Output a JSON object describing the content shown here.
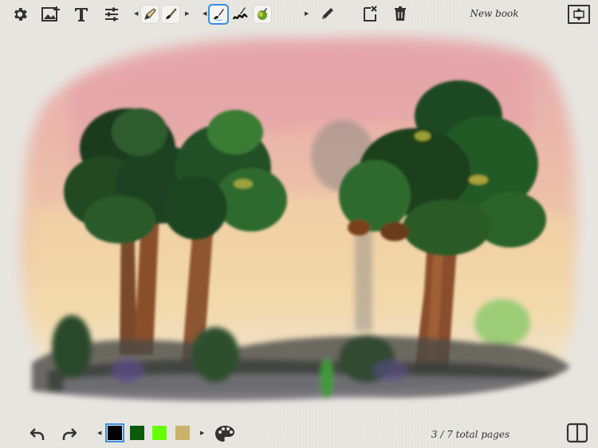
{
  "header": {
    "title": "New book",
    "icons": [
      "gear-icon",
      "add-image-icon",
      "text-icon",
      "sliders-icon",
      "pencil-tool-icon",
      "brush-tool-icon",
      "ink-brush-tool-icon",
      "squiggle-tool-icon",
      "paint-blob-tool-icon",
      "edit-icon",
      "clear-page-icon",
      "trash-icon",
      "fullscreen-icon"
    ]
  },
  "footer": {
    "page_indicator": "3 / 7 total pages",
    "colors": [
      "#000000",
      "#0a5c0a",
      "#66ff00",
      "#c8b46a"
    ],
    "icons": [
      "undo-icon",
      "redo-icon",
      "palette-icon",
      "book-view-icon"
    ]
  }
}
